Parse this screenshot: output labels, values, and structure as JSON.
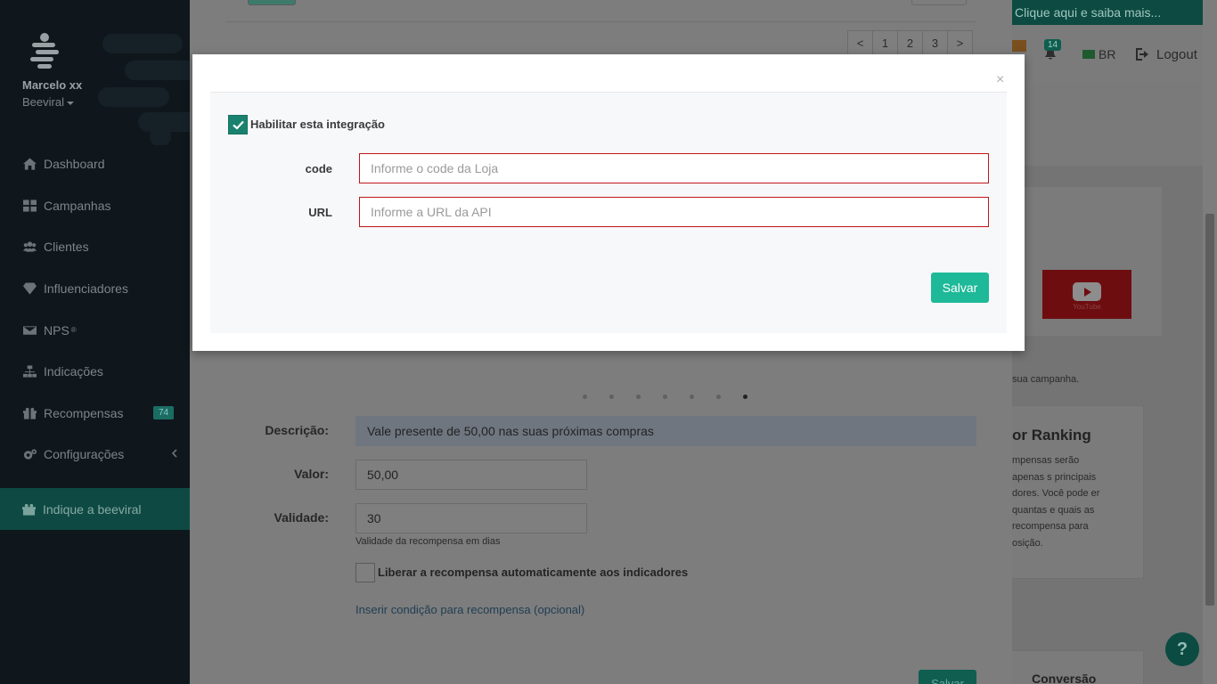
{
  "sidebar": {
    "user_name": "Marcelo xx",
    "company": "Beeviral",
    "items": [
      {
        "label": "Dashboard",
        "icon": "home-icon"
      },
      {
        "label": "Campanhas",
        "icon": "grid-icon"
      },
      {
        "label": "Clientes",
        "icon": "users-icon"
      },
      {
        "label": "Influenciadores",
        "icon": "diamond-icon"
      },
      {
        "label": "NPS",
        "icon": "envelope-icon",
        "sup": "®"
      },
      {
        "label": "Indicações",
        "icon": "sitemap-icon"
      },
      {
        "label": "Recompensas",
        "icon": "gift-icon",
        "badge": "74"
      },
      {
        "label": "Configurações",
        "icon": "cogs-icon"
      }
    ],
    "cta": "Indique a beeviral"
  },
  "topbar": {
    "banner": "Clique aqui e saiba mais...",
    "notifications": "14",
    "language": "BR",
    "logout": "Logout"
  },
  "pagination": [
    "<",
    "1",
    "2",
    "3",
    ">"
  ],
  "form": {
    "descricao_label": "Descrição:",
    "descricao_value": "Vale presente de 50,00 nas suas próximas compras",
    "valor_label": "Valor:",
    "valor_value": "50,00",
    "validade_label": "Validade:",
    "validade_value": "30",
    "validade_help": "Validade da recompensa em dias",
    "liberar_label": "Liberar a recompensa automaticamente aos indicadores",
    "condicao_link": "Inserir condição para recompensa (opcional)",
    "save_label": "Salvar"
  },
  "right_panel": {
    "youtube_label": "YouTube",
    "sua_campanha": "sua campanha.",
    "ranking_title": "or Ranking",
    "ranking_text": "mpensas serão apenas s principais dores. Você pode er quantas e quais as recompensa para osição.",
    "conversao": "Conversão"
  },
  "help_label": "?",
  "modal": {
    "close": "×",
    "enable_label": "Habilitar esta integração",
    "enable_checked": true,
    "code_label": "code",
    "code_placeholder": "Informe o code da Loja",
    "url_label": "URL",
    "url_placeholder": "Informe a URL da API",
    "save_label": "Salvar"
  },
  "colors": {
    "accent": "#1eb998",
    "error_border": "#c1161b",
    "sidebar_bg": "#0f171c"
  }
}
